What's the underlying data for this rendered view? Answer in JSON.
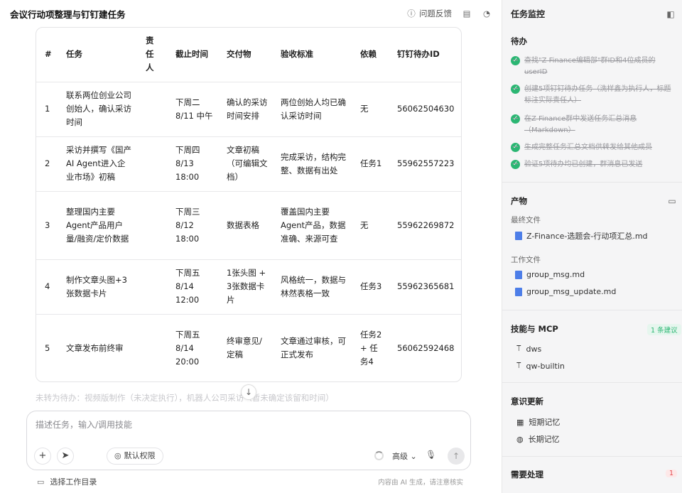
{
  "header": {
    "title": "会议行动项整理与钉钉建任务",
    "feedback_label": "问题反馈"
  },
  "table": {
    "columns": [
      "#",
      "任务",
      "责任人",
      "截止时间",
      "交付物",
      "验收标准",
      "依赖",
      "钉钉待办ID"
    ],
    "rows": [
      {
        "num": "1",
        "task": "联系两位创业公司创始人，确认采访时间",
        "owner": "",
        "due": "下周二 8/11 中午",
        "deliverable": "确认的采访时间安排",
        "criteria": "两位创始人均已确认采访时间",
        "dep": "无",
        "id": "56062504630"
      },
      {
        "num": "2",
        "task": "采访并撰写《国产AI Agent进入企业市场》初稿",
        "owner": "",
        "due": "下周四 8/13 18:00",
        "deliverable": "文章初稿（可编辑文档）",
        "criteria": "完成采访，结构完整、数据有出处",
        "dep": "任务1",
        "id": "55962557223"
      },
      {
        "num": "3",
        "task": "整理国内主要Agent产品用户量/融资/定价数据",
        "owner": "",
        "due": "下周三 8/12 18:00",
        "deliverable": "数据表格",
        "criteria": "覆盖国内主要Agent产品，数据准确、来源可查",
        "dep": "无",
        "id": "55962269872"
      },
      {
        "num": "4",
        "task": "制作文章头图+3张数据卡片",
        "owner": "",
        "due": "下周五 8/14 12:00",
        "deliverable": "1张头图 + 3张数据卡片",
        "criteria": "风格统一，数据与林然表格一致",
        "dep": "任务3",
        "id": "55962365681"
      },
      {
        "num": "5",
        "task": "文章发布前终审",
        "owner": "",
        "due": "下周五 8/14 20:00",
        "deliverable": "终审意见/定稿",
        "criteria": "文章通过审核，可正式发布",
        "dep": "任务2 + 任务4",
        "id": "56062592468"
      }
    ]
  },
  "faded_text": "未转为待办：视频版制作（未决定执行），机器人公司采访（暂未确定该留和时间）",
  "composer": {
    "placeholder": "描述任务，输入/调用技能",
    "permission_label": "默认权限",
    "mode_label": "高级"
  },
  "bottom": {
    "workdir_label": "选择工作目录",
    "disclaimer": "内容由 AI 生成，请注意核实"
  },
  "panel": {
    "title": "任务监控",
    "todo_title": "待办",
    "todos": [
      "查找\"Z Finance编辑部\"群ID和4位成员的userID",
      "创建5项钉钉待办任务（洗样鑫为执行人，标题标注实际责任人）",
      "在Z Finance群中发送任务汇总消息（Markdown）",
      "生成完整任务汇总文档供转发给其他成员",
      "验证5项待办均已创建，群消息已发送"
    ],
    "products_title": "产物",
    "final_label": "最终文件",
    "final_file": "Z-Finance-选题会-行动项汇总.md",
    "work_label": "工作文件",
    "work_files": [
      "group_msg.md",
      "group_msg_update.md"
    ],
    "skills_title": "技能与 MCP",
    "skills_badge": "1 条建议",
    "skills": [
      "dws",
      "qw-builtin"
    ],
    "memory_title": "意识更新",
    "memory": [
      "短期记忆",
      "长期记忆"
    ],
    "attention_title": "需要处理",
    "attention_count": "1"
  },
  "colors": {
    "accent_green": "#2bb673",
    "accent_red": "#e5484d",
    "file_blue": "#4d7ee8"
  }
}
